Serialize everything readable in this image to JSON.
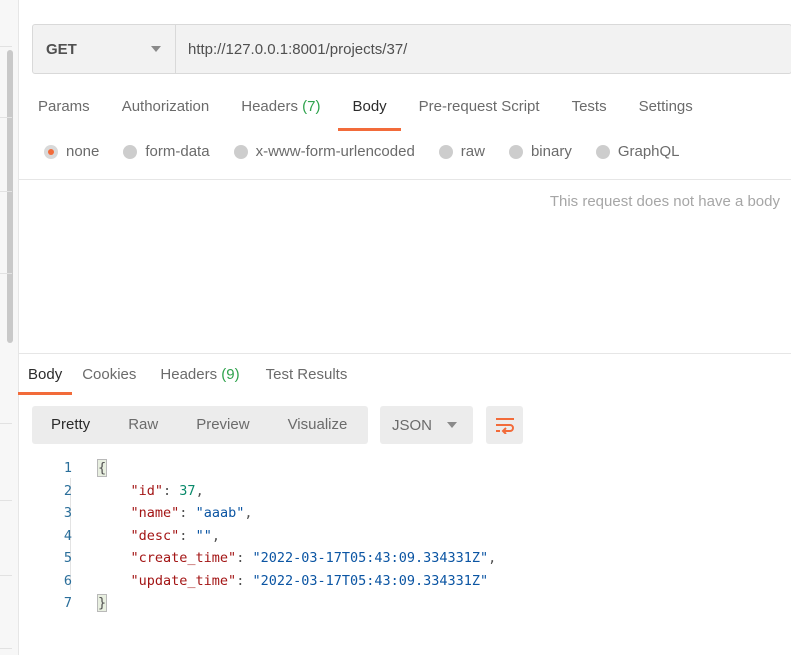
{
  "request": {
    "method": "GET",
    "url": "http://127.0.0.1:8001/projects/37/"
  },
  "request_tabs": [
    {
      "label": "Params",
      "count": ""
    },
    {
      "label": "Authorization",
      "count": ""
    },
    {
      "label": "Headers",
      "count": "(7)"
    },
    {
      "label": "Body",
      "count": ""
    },
    {
      "label": "Pre-request Script",
      "count": ""
    },
    {
      "label": "Tests",
      "count": ""
    },
    {
      "label": "Settings",
      "count": ""
    }
  ],
  "active_request_tab": "Body",
  "body_types": [
    {
      "label": "none",
      "checked": true
    },
    {
      "label": "form-data",
      "checked": false
    },
    {
      "label": "x-www-form-urlencoded",
      "checked": false
    },
    {
      "label": "raw",
      "checked": false
    },
    {
      "label": "binary",
      "checked": false
    },
    {
      "label": "GraphQL",
      "checked": false
    }
  ],
  "no_body_message": "This request does not have a body",
  "response_tabs": [
    {
      "label": "Body",
      "count": ""
    },
    {
      "label": "Cookies",
      "count": ""
    },
    {
      "label": "Headers",
      "count": "(9)"
    },
    {
      "label": "Test Results",
      "count": ""
    }
  ],
  "active_response_tab": "Body",
  "view_modes": [
    "Pretty",
    "Raw",
    "Preview",
    "Visualize"
  ],
  "active_view_mode": "Pretty",
  "format": "JSON",
  "icons": {
    "method_caret": "chevron-down-icon",
    "format_caret": "chevron-down-icon",
    "wrap": "wrap-lines-icon"
  },
  "colors": {
    "accent": "#f26b3a",
    "count_green": "#2fa34d"
  },
  "response_body": {
    "line_numbers": [
      "1",
      "2",
      "3",
      "4",
      "5",
      "6",
      "7"
    ],
    "open_brace": "{",
    "close_brace": "}",
    "fields": [
      {
        "key": "\"id\"",
        "value": "37",
        "type": "number",
        "comma": ","
      },
      {
        "key": "\"name\"",
        "value": "\"aaab\"",
        "type": "string",
        "comma": ","
      },
      {
        "key": "\"desc\"",
        "value": "\"\"",
        "type": "string",
        "comma": ","
      },
      {
        "key": "\"create_time\"",
        "value": "\"2022-03-17T05:43:09.334331Z\"",
        "type": "string",
        "comma": ","
      },
      {
        "key": "\"update_time\"",
        "value": "\"2022-03-17T05:43:09.334331Z\"",
        "type": "string",
        "comma": ""
      }
    ]
  }
}
